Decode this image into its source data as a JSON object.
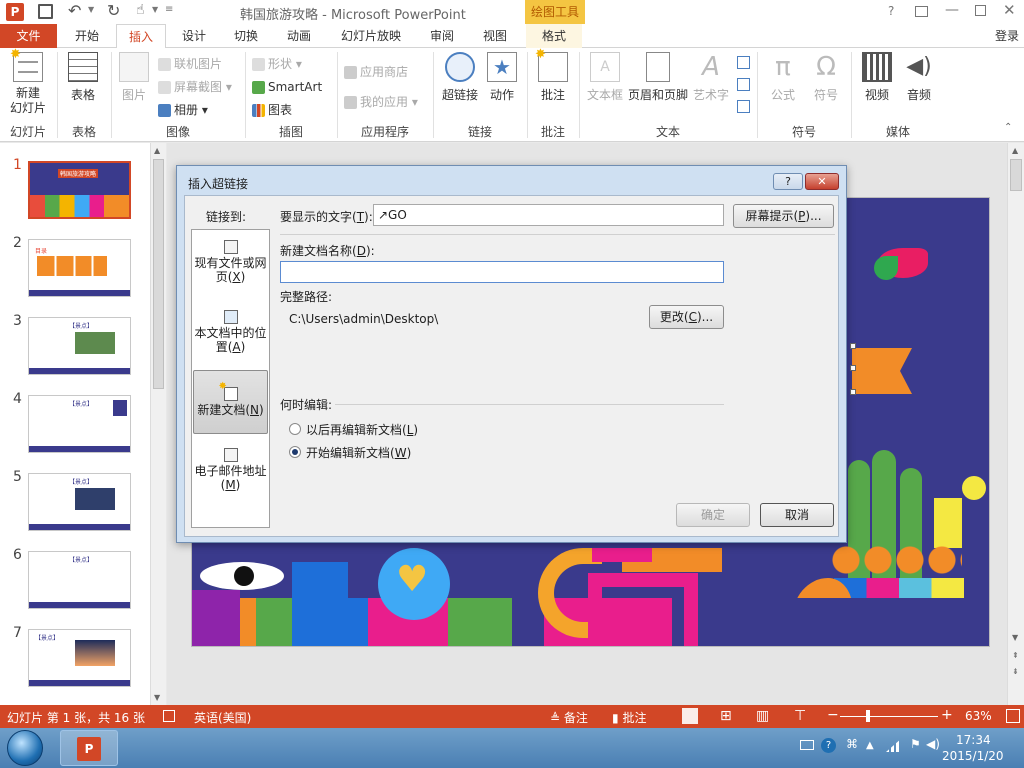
{
  "window": {
    "title": "韩国旅游攻略 - Microsoft PowerPoint",
    "context_tab": "绘图工具",
    "help": "?",
    "login": "登录"
  },
  "tabs": [
    {
      "label": "文件",
      "active": false
    },
    {
      "label": "开始"
    },
    {
      "label": "插入",
      "active": true
    },
    {
      "label": "设计"
    },
    {
      "label": "切换"
    },
    {
      "label": "动画"
    },
    {
      "label": "幻灯片放映"
    },
    {
      "label": "审阅"
    },
    {
      "label": "视图"
    },
    {
      "label": "格式"
    }
  ],
  "ribbon": {
    "new_slide": "新建\n幻灯片",
    "table": "表格",
    "picture": "图片",
    "online_pictures": "联机图片",
    "screenshot": "屏幕截图",
    "album": "相册",
    "shapes": "形状",
    "smartart": "SmartArt",
    "chart": "图表",
    "app_store": "应用商店",
    "my_apps": "我的应用",
    "hyperlink": "超链接",
    "action": "动作",
    "comment": "批注",
    "textbox": "文本框",
    "header_footer": "页眉和页脚",
    "wordart": "艺术字",
    "equation": "公式",
    "symbol": "符号",
    "video": "视频",
    "audio": "音频",
    "groups": {
      "slides": "幻灯片",
      "tables": "表格",
      "images": "图像",
      "illustrations": "插图",
      "apps": "应用程序",
      "links": "链接",
      "comments": "批注",
      "text": "文本",
      "symbols": "符号",
      "media": "媒体"
    }
  },
  "thumbnails": [
    "1",
    "2",
    "3",
    "4",
    "5",
    "6",
    "7"
  ],
  "thumb_texts": {
    "s1": "韩国旅游攻略",
    "s2": "目录",
    "s3": "【景点】",
    "s4": "【景点】",
    "s5": "【景点】",
    "s6": "【景点】",
    "s7": "【景点】"
  },
  "dialog": {
    "title": "插入超链接",
    "help": "?",
    "close": "✕",
    "link_to": "链接到:",
    "display_text_label": "要显示的文字(",
    "display_text_key": "T",
    "display_text_tail": "):",
    "display_text_value": "↗GO",
    "screen_tip_pre": "屏幕提示(",
    "screen_tip_key": "P",
    "screen_tip_post": ")...",
    "new_doc_label_pre": "新建文档名称(",
    "new_doc_label_key": "D",
    "new_doc_label_post": "):",
    "new_doc_value": "",
    "full_path_label": "完整路径:",
    "full_path_value": "C:\\Users\\admin\\Desktop\\",
    "change_pre": "更改(",
    "change_key": "C",
    "change_post": ")...",
    "when_edit": "何时编辑:",
    "edit_later_pre": "以后再编辑新文档(",
    "edit_later_key": "L",
    "edit_later_post": ")",
    "edit_now_pre": "开始编辑新文档(",
    "edit_now_key": "W",
    "edit_now_post": ")",
    "ok": "确定",
    "cancel": "取消",
    "link_options": [
      {
        "pre": "现有文件或网\n页(",
        "key": "X",
        "post": ")"
      },
      {
        "pre": "本文档中的位\n置(",
        "key": "A",
        "post": ")"
      },
      {
        "pre": "新建文档(",
        "key": "N",
        "post": ")"
      },
      {
        "pre": "电子邮件地址\n(",
        "key": "M",
        "post": ")"
      }
    ]
  },
  "status": {
    "slide_info": "幻灯片 第 1 张，共 16 张",
    "language": "英语(美国)",
    "notes": "备注",
    "comments": "批注",
    "zoom": "63%"
  },
  "taskbar": {
    "time": "17:34",
    "date": "2015/1/20"
  },
  "colors": {
    "accent": "#d24726",
    "context_tab": "#f4c542",
    "slide_bg": "#3a3a8c"
  }
}
